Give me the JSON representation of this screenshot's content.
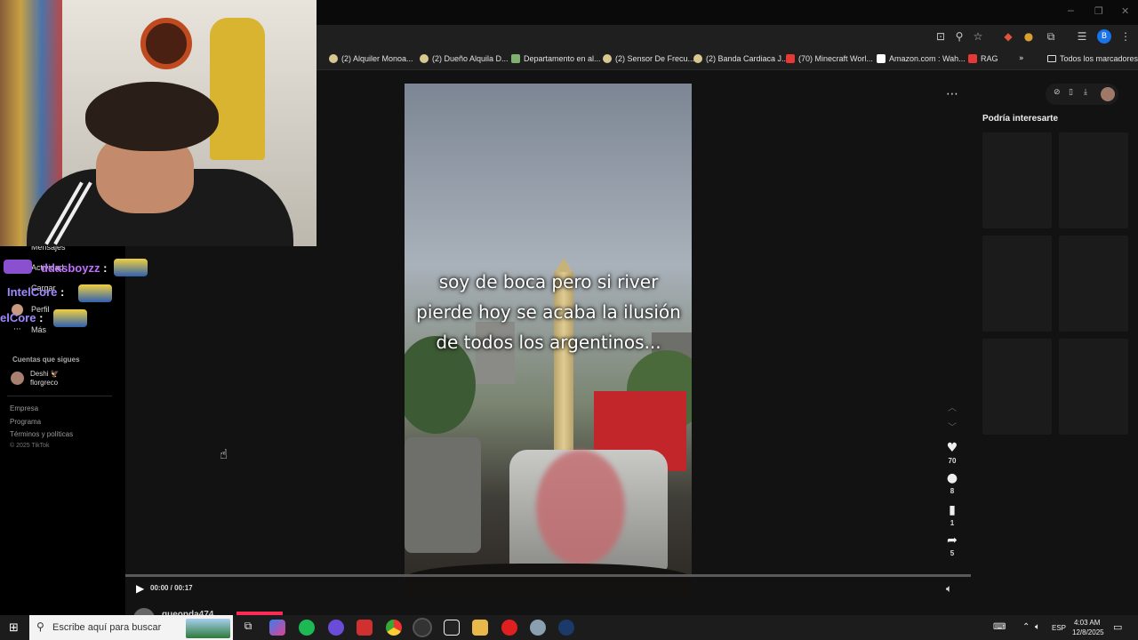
{
  "browser": {
    "bookmarks": [
      "(2) Alquiler Monoa...",
      "(2) Dueño Alquila D...",
      "Departamento en al...",
      "(2) Sensor De Frecu...",
      "(2) Banda Cardiaca J...",
      "(70) Minecraft Worl...",
      "Amazon.com : Wah...",
      "RAG"
    ],
    "all_bookmarks": "Todos los marcadores",
    "profile_initial": "B"
  },
  "sidebar": {
    "items": [
      "Mensajes",
      "Actividad",
      "Cargar",
      "Perfil",
      "Más"
    ],
    "following_title": "Cuentas que sigues",
    "following": [
      {
        "name": "Deshi 🦅",
        "handle": "florgreco"
      }
    ],
    "footer": [
      "Empresa",
      "Programa",
      "Términos y políticas",
      "© 2025 TikTok"
    ]
  },
  "chat": [
    {
      "user": "ddasboyzz",
      "sep": ":"
    },
    {
      "user": "IntelCore",
      "sep": ":"
    },
    {
      "user": "elCore",
      "sep": ":"
    }
  ],
  "video": {
    "caption": "soy de boca pero si river pierde hoy se acaba la ilusión de todos los argentinos...",
    "likes": "70",
    "comments": "8",
    "saves": "1",
    "shares": "5",
    "time": "00:00 / 00:17",
    "progress": 0.0,
    "author": "queonda474"
  },
  "right_panel": {
    "title": "Podría interesarte"
  },
  "taskbar": {
    "search_placeholder": "Escribe aquí para buscar",
    "lang": "ESP",
    "time": "4:03 AM",
    "date": "12/8/2025"
  },
  "colors": {
    "accent": "#fe2c55",
    "page_bg": "#121212"
  }
}
